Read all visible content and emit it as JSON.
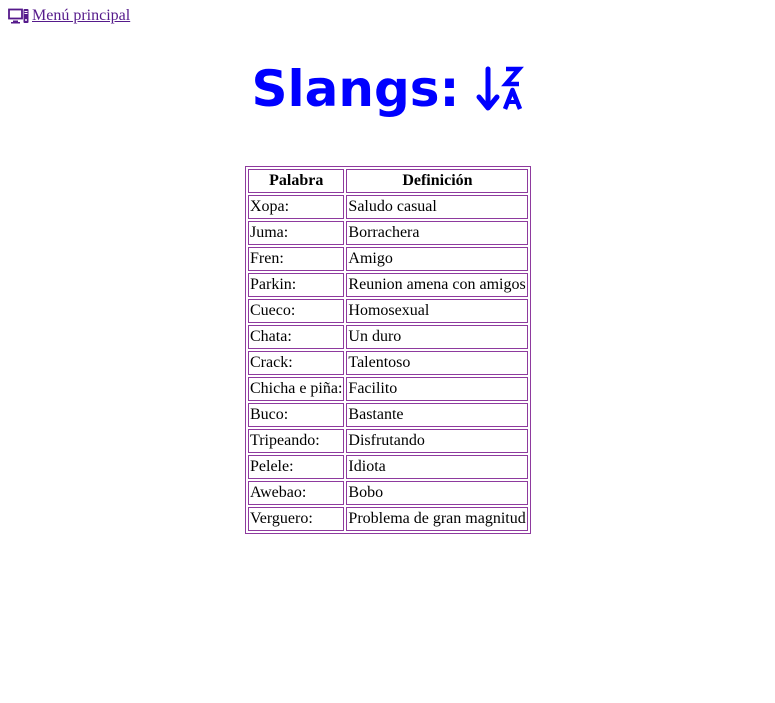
{
  "nav": {
    "menu_label": "Menú principal",
    "icon": "computer-icon"
  },
  "page": {
    "title": "Slangs:",
    "sort_icon": "sort-alpha-down-alt-icon",
    "title_color": "#0000ff"
  },
  "table": {
    "border_color": "#8e3a9e",
    "headers": [
      "Palabra",
      "Definición"
    ],
    "rows": [
      {
        "word": "Xopa:",
        "definition": "Saludo casual"
      },
      {
        "word": "Juma:",
        "definition": "Borrachera"
      },
      {
        "word": "Fren:",
        "definition": "Amigo"
      },
      {
        "word": "Parkin:",
        "definition": "Reunion amena con amigos"
      },
      {
        "word": "Cueco:",
        "definition": "Homosexual"
      },
      {
        "word": "Chata:",
        "definition": "Un duro"
      },
      {
        "word": "Crack:",
        "definition": "Talentoso"
      },
      {
        "word": "Chicha e piña:",
        "definition": "Facilito"
      },
      {
        "word": "Buco:",
        "definition": "Bastante"
      },
      {
        "word": "Tripeando:",
        "definition": "Disfrutando"
      },
      {
        "word": "Pelele:",
        "definition": "Idiota"
      },
      {
        "word": "Awebao:",
        "definition": "Bobo"
      },
      {
        "word": "Verguero:",
        "definition": "Problema de gran magnitud"
      }
    ]
  }
}
